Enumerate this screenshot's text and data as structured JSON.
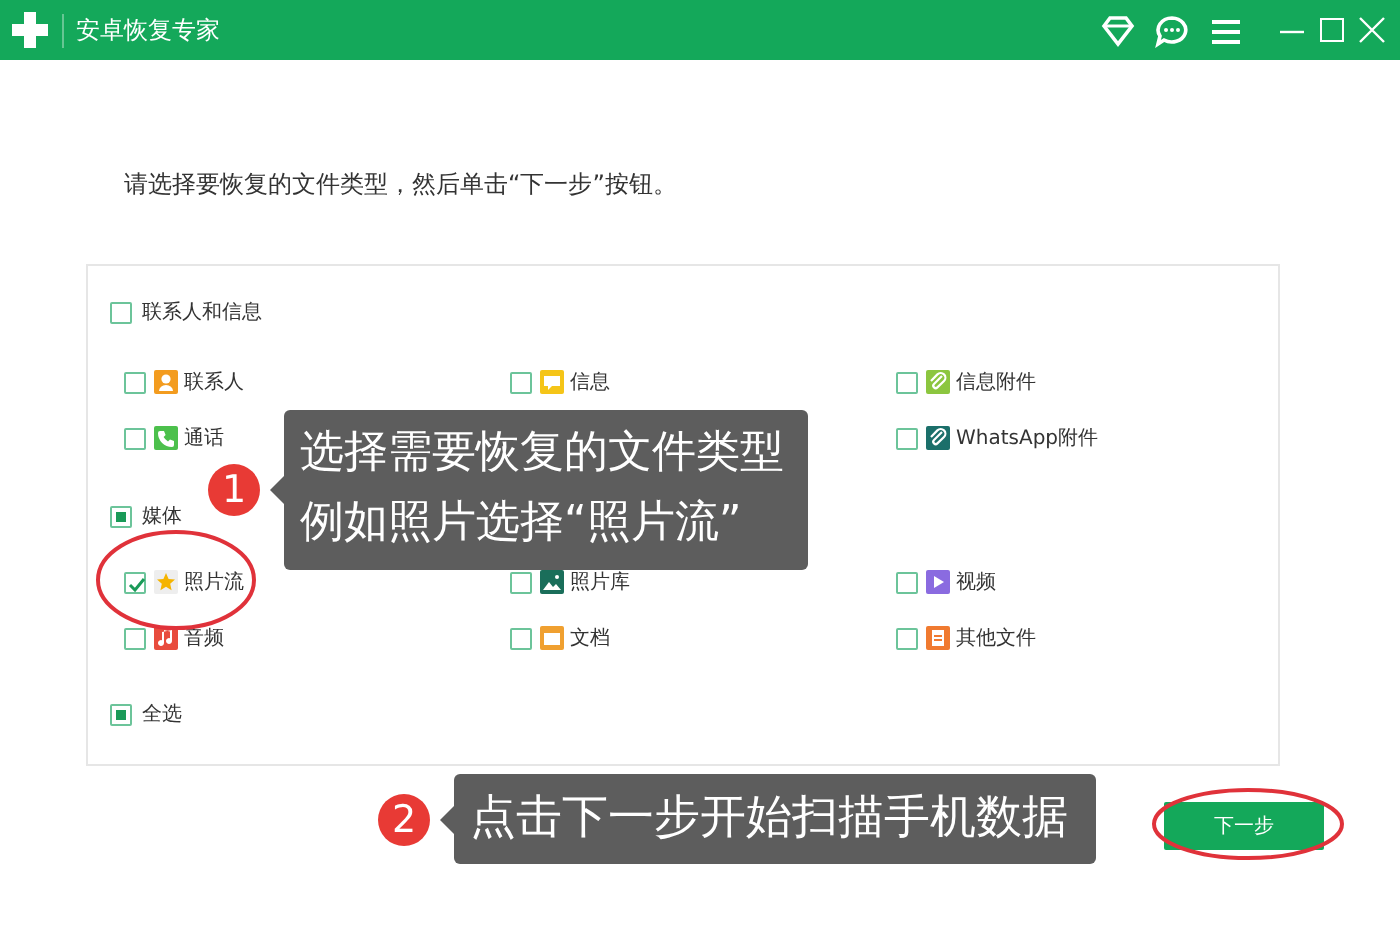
{
  "window": {
    "title": "安卓恢复专家"
  },
  "instruction": "请选择要恢复的文件类型，然后单击“下一步”按钮。",
  "groups": [
    {
      "label": "联系人和信息",
      "checked": false,
      "partial": false,
      "items": [
        {
          "label": "联系人",
          "kind": "contact",
          "color": "#f39c1f",
          "checked": false
        },
        {
          "label": "信息",
          "kind": "message",
          "color": "#f5c518",
          "checked": false
        },
        {
          "label": "信息附件",
          "kind": "attachment",
          "color": "#8cc63f",
          "checked": false
        },
        {
          "label": "通话",
          "kind": "call",
          "color": "#4cc04c",
          "checked": false
        },
        {
          "label": "WhatsApp附件",
          "kind": "attachment",
          "color": "#1b6f6a",
          "checked": false
        }
      ]
    },
    {
      "label": "媒体",
      "checked": false,
      "partial": true,
      "items": [
        {
          "label": "照片流",
          "kind": "star",
          "color": "#eeeeee",
          "checked": true
        },
        {
          "label": "照片库",
          "kind": "picture",
          "color": "#1a6e5a",
          "checked": false
        },
        {
          "label": "视频",
          "kind": "video",
          "color": "#8a6be0",
          "checked": false
        },
        {
          "label": "音频",
          "kind": "music",
          "color": "#e84c3d",
          "checked": false
        },
        {
          "label": "文档",
          "kind": "folder",
          "color": "#f0a030",
          "checked": false
        },
        {
          "label": "其他文件",
          "kind": "file",
          "color": "#f07a30",
          "checked": false
        }
      ]
    }
  ],
  "select_all": {
    "label": "全选",
    "checked": false,
    "partial": true
  },
  "next_button": "下一步",
  "callouts": [
    {
      "number": "1",
      "lines": [
        "选择需要恢复的文件类型",
        "例如照片选择“照片流”"
      ]
    },
    {
      "number": "2",
      "lines": [
        "点击下一步开始扫描手机数据"
      ]
    }
  ]
}
